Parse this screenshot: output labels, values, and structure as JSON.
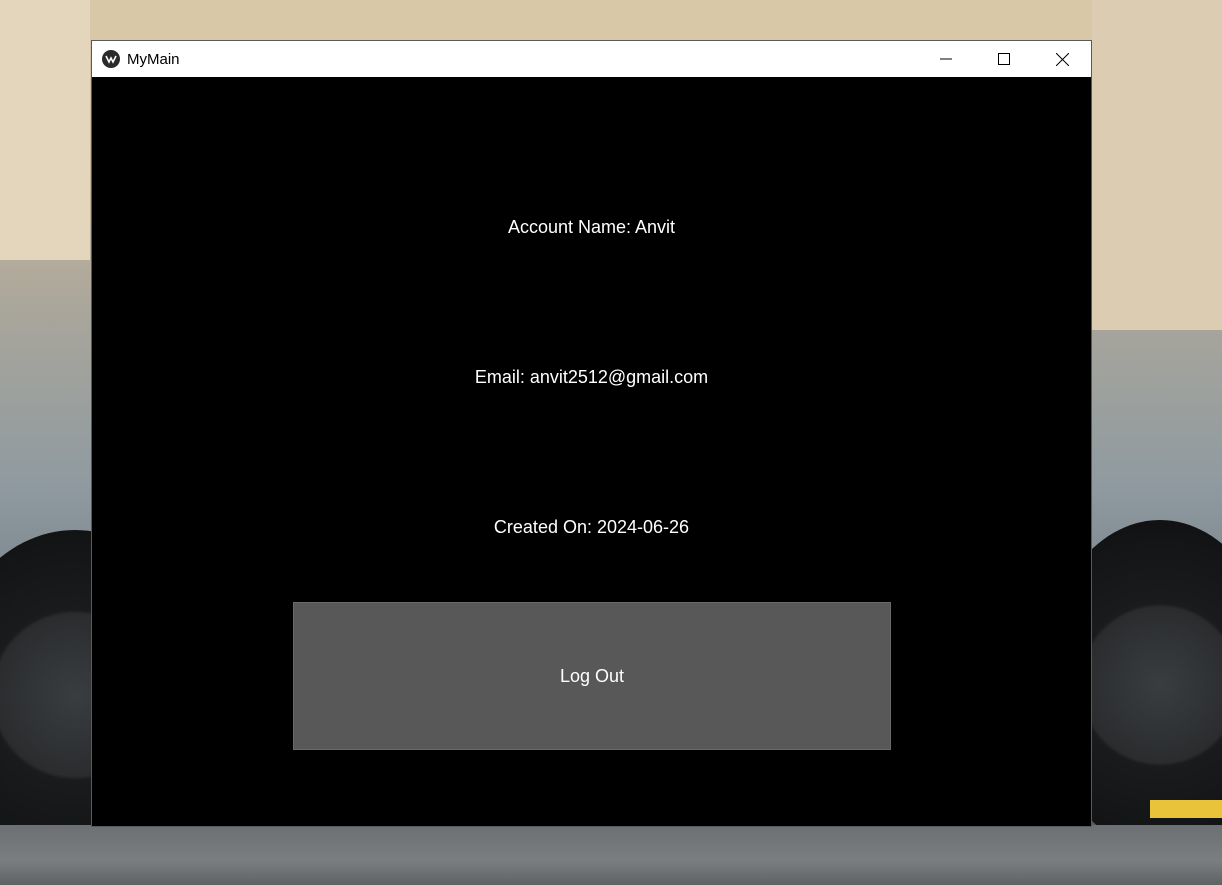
{
  "window": {
    "title": "MyMain",
    "app_icon": "kivy-logo-icon",
    "controls": {
      "minimize_icon": "minimize-icon",
      "maximize_icon": "maximize-icon",
      "close_icon": "close-icon"
    }
  },
  "account": {
    "name_text": "Account Name: Anvit",
    "email_text": "Email: anvit2512@gmail.com",
    "created_text": "Created On: 2024-06-26"
  },
  "actions": {
    "logout_label": "Log Out"
  },
  "colors": {
    "content_bg": "#000000",
    "button_bg": "#585858",
    "text": "#ffffff",
    "titlebar_bg": "#ffffff"
  }
}
